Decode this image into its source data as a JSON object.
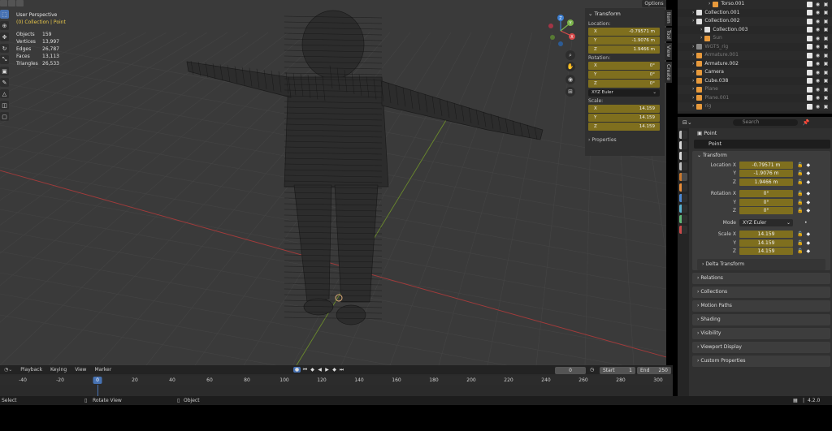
{
  "viewport": {
    "view_name": "User Perspective",
    "context": "(0) Collection | Point",
    "stats": [
      {
        "label": "Objects",
        "value": "159"
      },
      {
        "label": "Vertices",
        "value": "13,997"
      },
      {
        "label": "Edges",
        "value": "26,787"
      },
      {
        "label": "Faces",
        "value": "13,113"
      },
      {
        "label": "Triangles",
        "value": "26,533"
      }
    ],
    "options_label": "Options",
    "gizmo_axes": [
      "Z",
      "Y",
      "X"
    ]
  },
  "npanel": {
    "header": "Transform",
    "location_label": "Location:",
    "location": [
      {
        "axis": "X",
        "value": "-0.79571 m"
      },
      {
        "axis": "Y",
        "value": "-1.9076 m"
      },
      {
        "axis": "Z",
        "value": "1.9466 m"
      }
    ],
    "rotation_label": "Rotation:",
    "rotation": [
      {
        "axis": "X",
        "value": "0°"
      },
      {
        "axis": "Y",
        "value": "0°"
      },
      {
        "axis": "Z",
        "value": "0°"
      }
    ],
    "rotation_mode": "XYZ Euler",
    "scale_label": "Scale:",
    "scale": [
      {
        "axis": "X",
        "value": "14.159"
      },
      {
        "axis": "Y",
        "value": "14.159"
      },
      {
        "axis": "Z",
        "value": "14.159"
      }
    ],
    "properties_label": "Properties",
    "tabs": [
      "Item",
      "Tool",
      "View",
      "Create"
    ]
  },
  "timeline": {
    "menus": [
      "Playback",
      "Keying",
      "View",
      "Marker"
    ],
    "current_frame": "0",
    "start_label": "Start",
    "start_value": "1",
    "end_label": "End",
    "end_value": "250",
    "ticks": [
      "-40",
      "-20",
      "0",
      "20",
      "40",
      "60",
      "80",
      "100",
      "120",
      "140",
      "160",
      "180",
      "200",
      "220",
      "240",
      "260",
      "280",
      "300"
    ],
    "playhead_frame": "0"
  },
  "statusbar": {
    "left": "Select",
    "mid": "Rotate View",
    "right": "Object",
    "version": "4.2.0"
  },
  "outliner": {
    "rows": [
      {
        "name": "Torso.001",
        "indent": 3,
        "color": "#e89a3c",
        "dim": false
      },
      {
        "name": "Collection.001",
        "indent": 1,
        "color": "#e0e0e0",
        "dim": false
      },
      {
        "name": "Collection.002",
        "indent": 1,
        "color": "#e0e0e0",
        "dim": false
      },
      {
        "name": "Collection.003",
        "indent": 2,
        "color": "#e0e0e0",
        "dim": false
      },
      {
        "name": "Sun",
        "indent": 2,
        "color": "#e89a3c",
        "dim": true
      },
      {
        "name": "WGTS_rig",
        "indent": 1,
        "color": "#888888",
        "dim": true
      },
      {
        "name": "Armature.001",
        "indent": 1,
        "color": "#e89a3c",
        "dim": true
      },
      {
        "name": "Armature.002",
        "indent": 1,
        "color": "#e89a3c",
        "dim": false
      },
      {
        "name": "Camera",
        "indent": 1,
        "color": "#e89a3c",
        "dim": false
      },
      {
        "name": "Cube.038",
        "indent": 1,
        "color": "#e89a3c",
        "dim": false
      },
      {
        "name": "Plane",
        "indent": 1,
        "color": "#e89a3c",
        "dim": true
      },
      {
        "name": "Plane.001",
        "indent": 1,
        "color": "#e89a3c",
        "dim": true
      },
      {
        "name": "rig",
        "indent": 1,
        "color": "#e89a3c",
        "dim": true
      }
    ]
  },
  "properties": {
    "object_name": "Point",
    "datablock_name": "Point",
    "search_placeholder": "Search",
    "transform_header": "Transform",
    "location_label": "Location X",
    "location": [
      {
        "label": "Location X",
        "value": "-0.79571 m"
      },
      {
        "label": "Y",
        "value": "-1.9076 m"
      },
      {
        "label": "Z",
        "value": "1.9466 m"
      }
    ],
    "rotation": [
      {
        "label": "Rotation X",
        "value": "0°"
      },
      {
        "label": "Y",
        "value": "0°"
      },
      {
        "label": "Z",
        "value": "0°"
      }
    ],
    "mode_label": "Mode",
    "mode_value": "XYZ Euler",
    "scale": [
      {
        "label": "Scale X",
        "value": "14.159"
      },
      {
        "label": "Y",
        "value": "14.159"
      },
      {
        "label": "Z",
        "value": "14.159"
      }
    ],
    "delta_transform": "Delta Transform",
    "sections": [
      "Relations",
      "Collections",
      "Motion Paths",
      "Shading",
      "Visibility",
      "Viewport Display",
      "Custom Properties"
    ],
    "tab_colors": [
      "#bbbbbb",
      "#d8d8d8",
      "#d8d8d8",
      "#bbbbbb",
      "#cc7a2e",
      "#e88d3a",
      "#4c8ad6",
      "#59b2d0",
      "#5fb878",
      "#cc4a4a"
    ]
  }
}
